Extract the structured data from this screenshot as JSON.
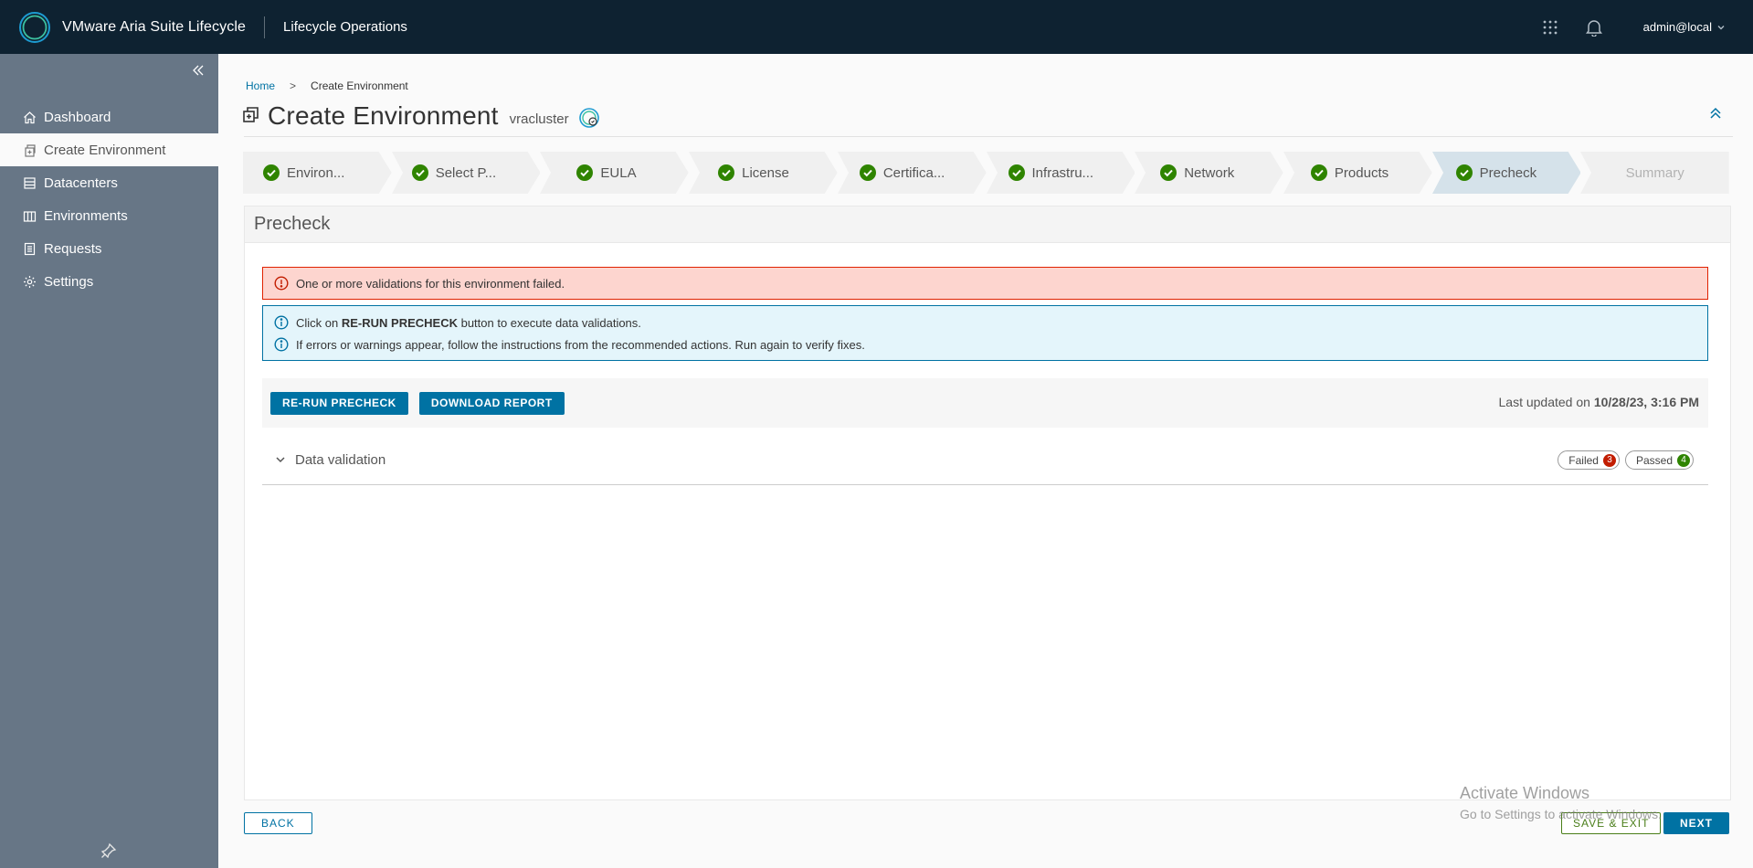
{
  "header": {
    "app_title": "VMware Aria Suite Lifecycle",
    "section_title": "Lifecycle Operations",
    "user": "admin@local"
  },
  "sidebar": {
    "items": [
      {
        "label": "Dashboard",
        "icon": "home-icon"
      },
      {
        "label": "Create Environment",
        "icon": "create-environment-icon",
        "active": true
      },
      {
        "label": "Datacenters",
        "icon": "datacenter-icon"
      },
      {
        "label": "Environments",
        "icon": "environments-icon"
      },
      {
        "label": "Requests",
        "icon": "requests-icon"
      },
      {
        "label": "Settings",
        "icon": "gear-icon"
      }
    ]
  },
  "breadcrumb": {
    "home": "Home",
    "separator": ">",
    "current": "Create Environment"
  },
  "page": {
    "title": "Create Environment",
    "subtitle": "vracluster"
  },
  "stepper": {
    "steps": [
      {
        "label": "Environ...",
        "state": "complete"
      },
      {
        "label": "Select P...",
        "state": "complete"
      },
      {
        "label": "EULA",
        "state": "complete"
      },
      {
        "label": "License",
        "state": "complete"
      },
      {
        "label": "Certifica...",
        "state": "complete"
      },
      {
        "label": "Infrastru...",
        "state": "complete"
      },
      {
        "label": "Network",
        "state": "complete"
      },
      {
        "label": "Products",
        "state": "complete"
      },
      {
        "label": "Precheck",
        "state": "current"
      },
      {
        "label": "Summary",
        "state": "disabled"
      }
    ]
  },
  "precheck": {
    "heading": "Precheck",
    "error_alert": "One or more validations for this environment failed.",
    "info_line1_prefix": "Click on ",
    "info_line1_bold": "RE-RUN PRECHECK",
    "info_line1_suffix": " button to execute data validations.",
    "info_line2": "If errors or warnings appear, follow the instructions from the recommended actions. Run again to verify fixes.",
    "rerun_label": "RE-RUN PRECHECK",
    "download_label": "DOWNLOAD REPORT",
    "last_updated_prefix": "Last updated on ",
    "last_updated_value": "10/28/23, 3:16 PM",
    "section_label": "Data validation",
    "failed_label": "Failed",
    "failed_count": "3",
    "passed_label": "Passed",
    "passed_count": "4"
  },
  "footer": {
    "back_label": "BACK",
    "save_exit_label": "SAVE & EXIT",
    "next_label": "NEXT"
  },
  "watermark": {
    "title": "Activate Windows",
    "subtitle": "Go to Settings to activate Windows."
  },
  "colors": {
    "header_bg": "#0e2231",
    "sidebar_bg": "#677686",
    "primary": "#0072a3",
    "success": "#2f8400",
    "danger": "#c21d00",
    "danger_bg": "#fdd5cf",
    "info_bg": "#e4f5fb"
  }
}
